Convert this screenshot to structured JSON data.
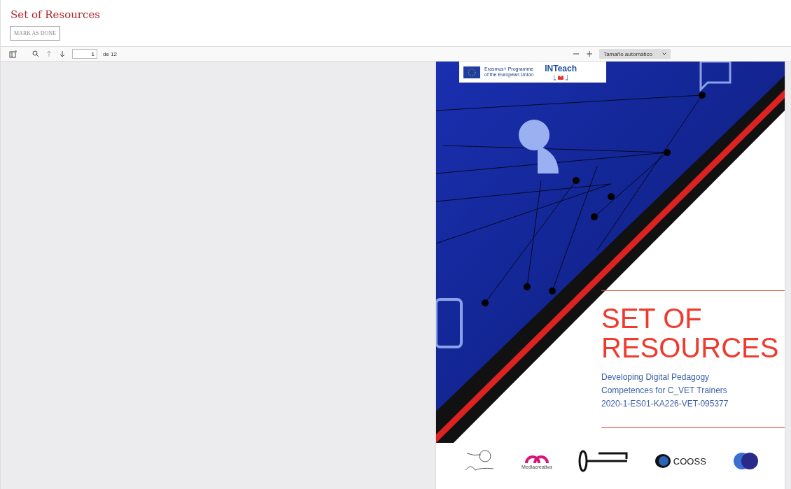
{
  "title": "Set of Resources",
  "mark_button": "MARK AS DONE",
  "toolbar": {
    "page_input": "1",
    "page_count": "de 12",
    "zoom_select": "Tamaño automático"
  },
  "document": {
    "eu_lines": [
      "Erasmus+ Programme",
      "of the European Union"
    ],
    "project_logo": "INTeach",
    "heading_lines": [
      "SET OF",
      "RESOURCES"
    ],
    "subtitle_lines": [
      "Developing Digital Pedagogy",
      "Competences for C_VET Trainers",
      "2020-1-ES01-KA226-VET-095377"
    ],
    "partners": [
      {
        "kind": "script"
      },
      {
        "kind": "arch",
        "label": "Mediacreativa"
      },
      {
        "kind": "key"
      },
      {
        "kind": "ring",
        "label": "COOSS"
      },
      {
        "kind": "circles"
      }
    ]
  }
}
